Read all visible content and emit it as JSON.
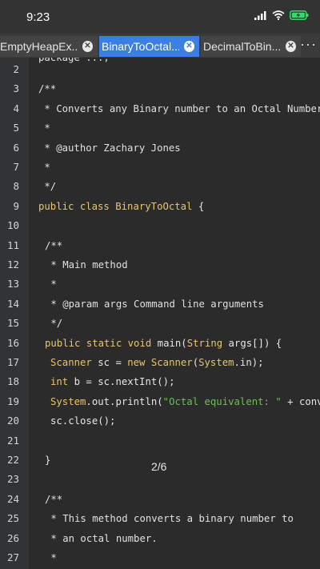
{
  "status": {
    "time": "9:23"
  },
  "tabs": [
    {
      "label": "EmptyHeapEx...",
      "active": false
    },
    {
      "label": "BinaryToOctal...",
      "active": true
    },
    {
      "label": "DecimalToBin...",
      "active": false
    }
  ],
  "tab_more": "···",
  "page_indicator": "2/6",
  "colors": {
    "background": "#2b2b2b",
    "active_tab": "#3b7ee6",
    "keyword": "#e8c56b",
    "string": "#6dbd5c"
  },
  "code": {
    "partial_top": "package ...;",
    "lines": [
      {
        "n": "2",
        "indent": 1,
        "segments": []
      },
      {
        "n": "3",
        "indent": 1,
        "segments": [
          {
            "t": "/**",
            "c": "cm"
          }
        ]
      },
      {
        "n": "4",
        "indent": 1,
        "segments": [
          {
            "t": " * Converts any Binary number to an Octal Number",
            "c": "cm"
          }
        ]
      },
      {
        "n": "5",
        "indent": 1,
        "segments": [
          {
            "t": " *",
            "c": "cm"
          }
        ]
      },
      {
        "n": "6",
        "indent": 1,
        "segments": [
          {
            "t": " * @author Zachary Jones",
            "c": "cm"
          }
        ]
      },
      {
        "n": "7",
        "indent": 1,
        "segments": [
          {
            "t": " *",
            "c": "cm"
          }
        ]
      },
      {
        "n": "8",
        "indent": 1,
        "segments": [
          {
            "t": " */",
            "c": "cm"
          }
        ]
      },
      {
        "n": "9",
        "indent": 1,
        "segments": [
          {
            "t": "public class ",
            "c": "kw"
          },
          {
            "t": "BinaryToOctal",
            "c": "ty"
          },
          {
            "t": " {",
            "c": "pl"
          }
        ]
      },
      {
        "n": "10",
        "indent": 1,
        "segments": []
      },
      {
        "n": "11",
        "indent": 2,
        "segments": [
          {
            "t": "/**",
            "c": "cm"
          }
        ]
      },
      {
        "n": "12",
        "indent": 2,
        "segments": [
          {
            "t": " * Main method",
            "c": "cm"
          }
        ]
      },
      {
        "n": "13",
        "indent": 2,
        "segments": [
          {
            "t": " *",
            "c": "cm"
          }
        ]
      },
      {
        "n": "14",
        "indent": 2,
        "segments": [
          {
            "t": " * @param args Command line arguments",
            "c": "cm"
          }
        ]
      },
      {
        "n": "15",
        "indent": 2,
        "segments": [
          {
            "t": " */",
            "c": "cm"
          }
        ]
      },
      {
        "n": "16",
        "indent": 2,
        "segments": [
          {
            "t": "public static void ",
            "c": "kw"
          },
          {
            "t": "main(",
            "c": "pl"
          },
          {
            "t": "String",
            "c": "ty"
          },
          {
            "t": " args[]) {",
            "c": "pl"
          }
        ]
      },
      {
        "n": "17",
        "indent": 3,
        "segments": [
          {
            "t": "Scanner",
            "c": "ty"
          },
          {
            "t": " sc = ",
            "c": "pl"
          },
          {
            "t": "new ",
            "c": "kw"
          },
          {
            "t": "Scanner",
            "c": "ty"
          },
          {
            "t": "(",
            "c": "pl"
          },
          {
            "t": "System",
            "c": "ty"
          },
          {
            "t": ".in);",
            "c": "pl"
          }
        ]
      },
      {
        "n": "18",
        "indent": 3,
        "segments": [
          {
            "t": "int ",
            "c": "kw"
          },
          {
            "t": "b = sc.nextInt();",
            "c": "pl"
          }
        ]
      },
      {
        "n": "19",
        "indent": 3,
        "segments": [
          {
            "t": "System",
            "c": "ty"
          },
          {
            "t": ".out.println(",
            "c": "pl"
          },
          {
            "t": "\"Octal equivalent: \"",
            "c": "st"
          },
          {
            "t": " + convertBinaryToOctal(b));",
            "c": "pl"
          }
        ]
      },
      {
        "n": "20",
        "indent": 3,
        "segments": [
          {
            "t": "sc.close();",
            "c": "pl"
          }
        ]
      },
      {
        "n": "21",
        "indent": 3,
        "segments": []
      },
      {
        "n": "22",
        "indent": 2,
        "segments": [
          {
            "t": "}",
            "c": "pl"
          }
        ]
      },
      {
        "n": "23",
        "indent": 1,
        "segments": []
      },
      {
        "n": "24",
        "indent": 2,
        "segments": [
          {
            "t": "/**",
            "c": "cm"
          }
        ]
      },
      {
        "n": "25",
        "indent": 2,
        "segments": [
          {
            "t": " * This method converts a binary number to",
            "c": "cm"
          }
        ]
      },
      {
        "n": "26",
        "indent": 2,
        "segments": [
          {
            "t": " * an octal number.",
            "c": "cm"
          }
        ]
      },
      {
        "n": "27",
        "indent": 2,
        "segments": [
          {
            "t": " *",
            "c": "cm"
          }
        ]
      }
    ]
  }
}
